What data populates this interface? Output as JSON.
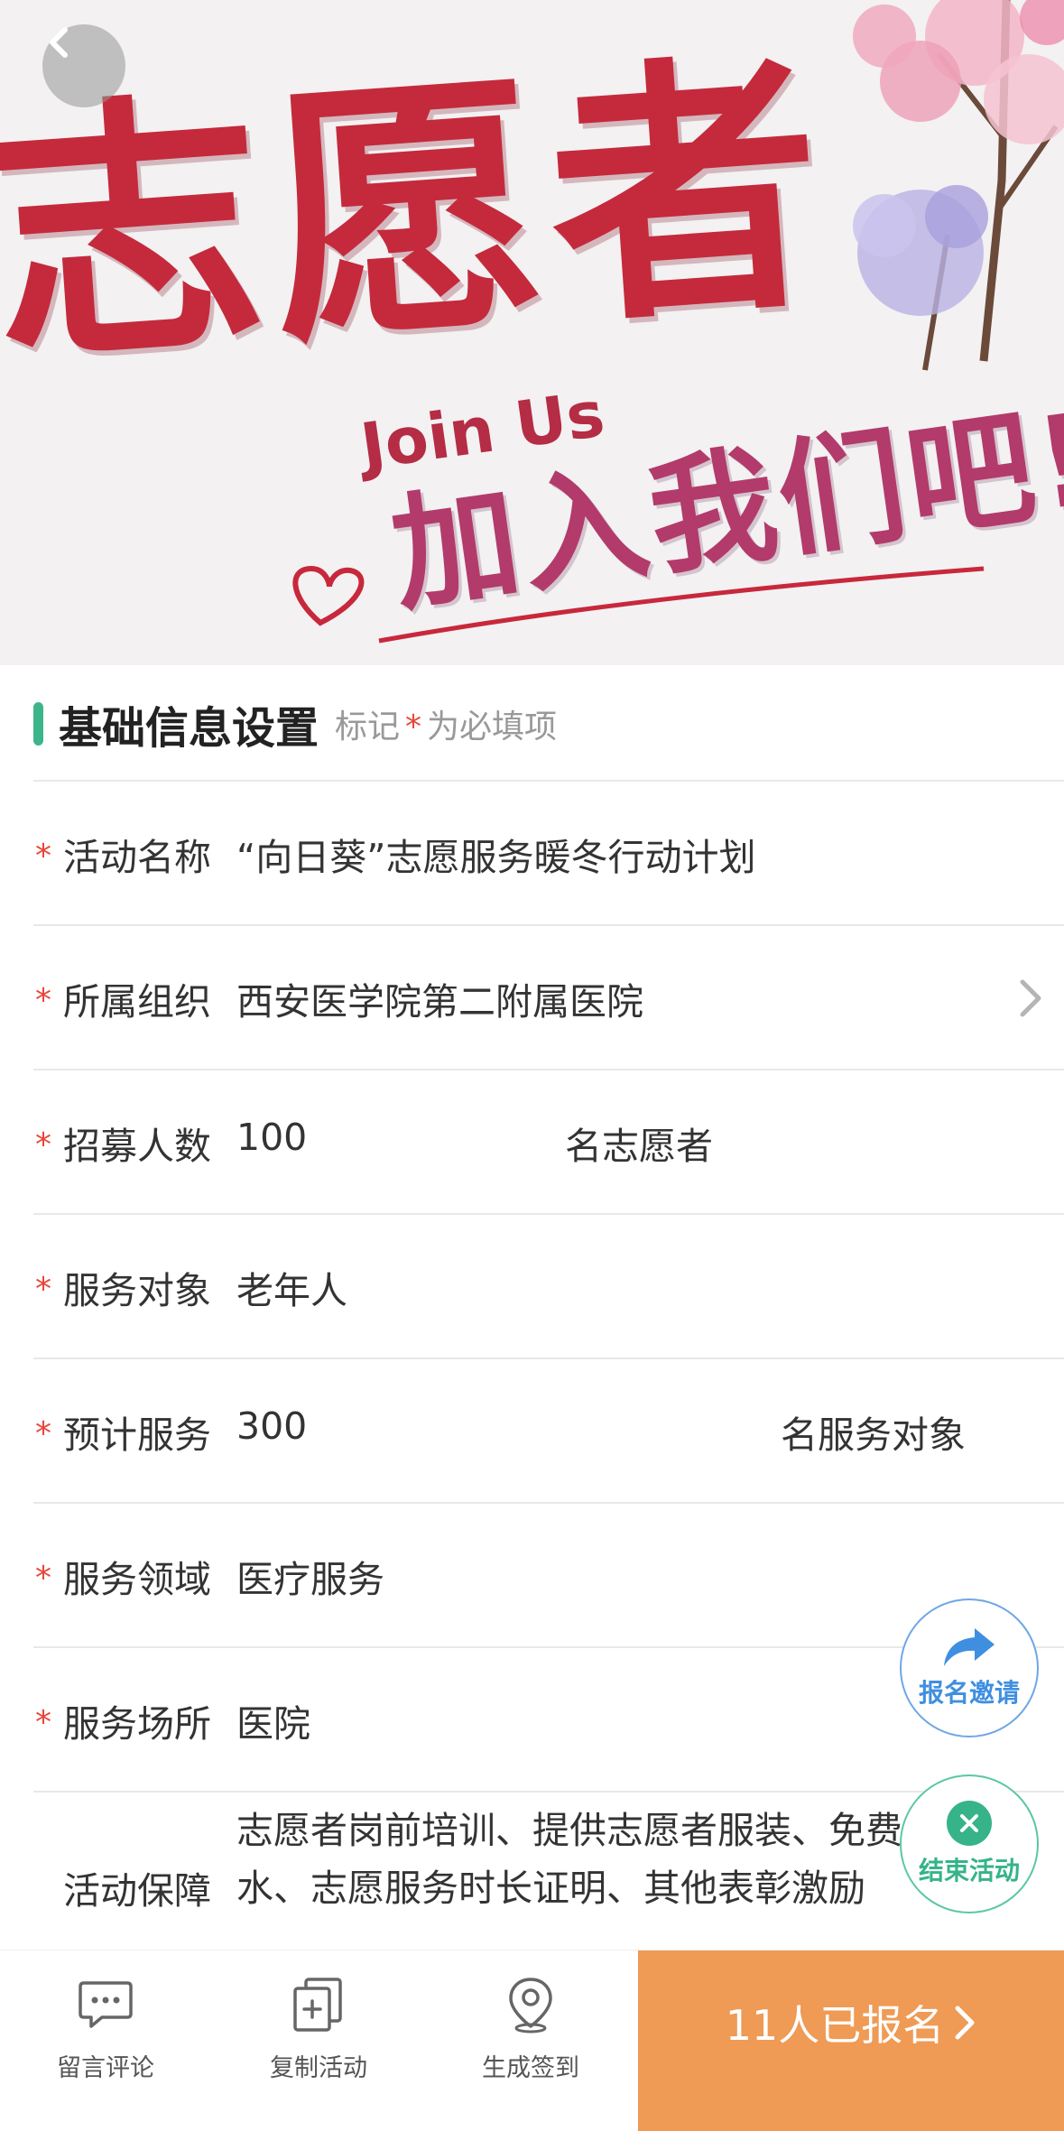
{
  "banner": {
    "title": "志愿者",
    "english": "Join Us",
    "slogan": "加入我们吧!"
  },
  "section": {
    "title": "基础信息设置",
    "note_prefix": "标记",
    "note_star": "*",
    "note_suffix": "为必填项"
  },
  "form": {
    "required_mark": "*",
    "rows": [
      {
        "label": "活动名称",
        "value": "“向日葵”志愿服务暖冬行动计划",
        "required": true
      },
      {
        "label": "所属组织",
        "value": "西安医学院第二附属医院",
        "required": true,
        "has_arrow": true
      },
      {
        "label": "招募人数",
        "value": "100",
        "suffix": "名志愿者",
        "required": true
      },
      {
        "label": "服务对象",
        "value": "老年人",
        "required": true
      },
      {
        "label": "预计服务",
        "value": "300",
        "suffix": "名服务对象",
        "required": true
      },
      {
        "label": "服务领域",
        "value": "医疗服务",
        "required": true
      },
      {
        "label": "服务场所",
        "value": "医院",
        "required": true
      },
      {
        "label": "活动保障",
        "value": "志愿者岗前培训、提供志愿者服装、免费饮水、志愿服务时长证明、其他表彰激励",
        "required": false
      }
    ]
  },
  "fabs": {
    "invite_label": "报名邀请",
    "end_label": "结束活动"
  },
  "bottom_bar": {
    "tabs": [
      {
        "label": "留言评论",
        "icon": "chat-bubble-icon"
      },
      {
        "label": "复制活动",
        "icon": "copy-icon"
      },
      {
        "label": "生成签到",
        "icon": "location-pin-icon"
      }
    ],
    "signup_label": "11人已报名"
  },
  "colors": {
    "accent_green": "#3cb58a",
    "required_red": "#e8463a",
    "invite_blue": "#3f8fe0",
    "signup_orange": "#ef9a55"
  }
}
